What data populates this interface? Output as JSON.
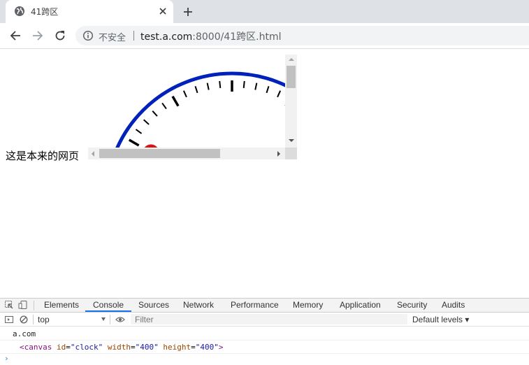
{
  "tab": {
    "title": "41跨区",
    "favicon": "globe-icon"
  },
  "toolbar": {
    "insecure_label": "不安全",
    "url_host": "test.a.com",
    "url_rest": ":8000/41跨区.html"
  },
  "page": {
    "text": "这是本来的网页"
  },
  "devtools": {
    "tabs": [
      "Elements",
      "Console",
      "Sources",
      "Network",
      "Performance",
      "Memory",
      "Application",
      "Security",
      "Audits"
    ],
    "active_tab": "Console",
    "context": "top",
    "filter_placeholder": "Filter",
    "levels": "Default levels ▾",
    "log_1": "a.com",
    "log_2_tag_open": "<canvas",
    "log_2_attr_id": "id",
    "log_2_val_id": "\"clock\"",
    "log_2_attr_w": "width",
    "log_2_val_w": "\"400\"",
    "log_2_attr_h": "height",
    "log_2_val_h": "\"400\"",
    "log_2_tag_close": ">",
    "prompt": "›"
  },
  "colors": {
    "clock_ring": "#0022bb",
    "clock_marker": "#dd1111",
    "accent": "#1a73e8"
  }
}
